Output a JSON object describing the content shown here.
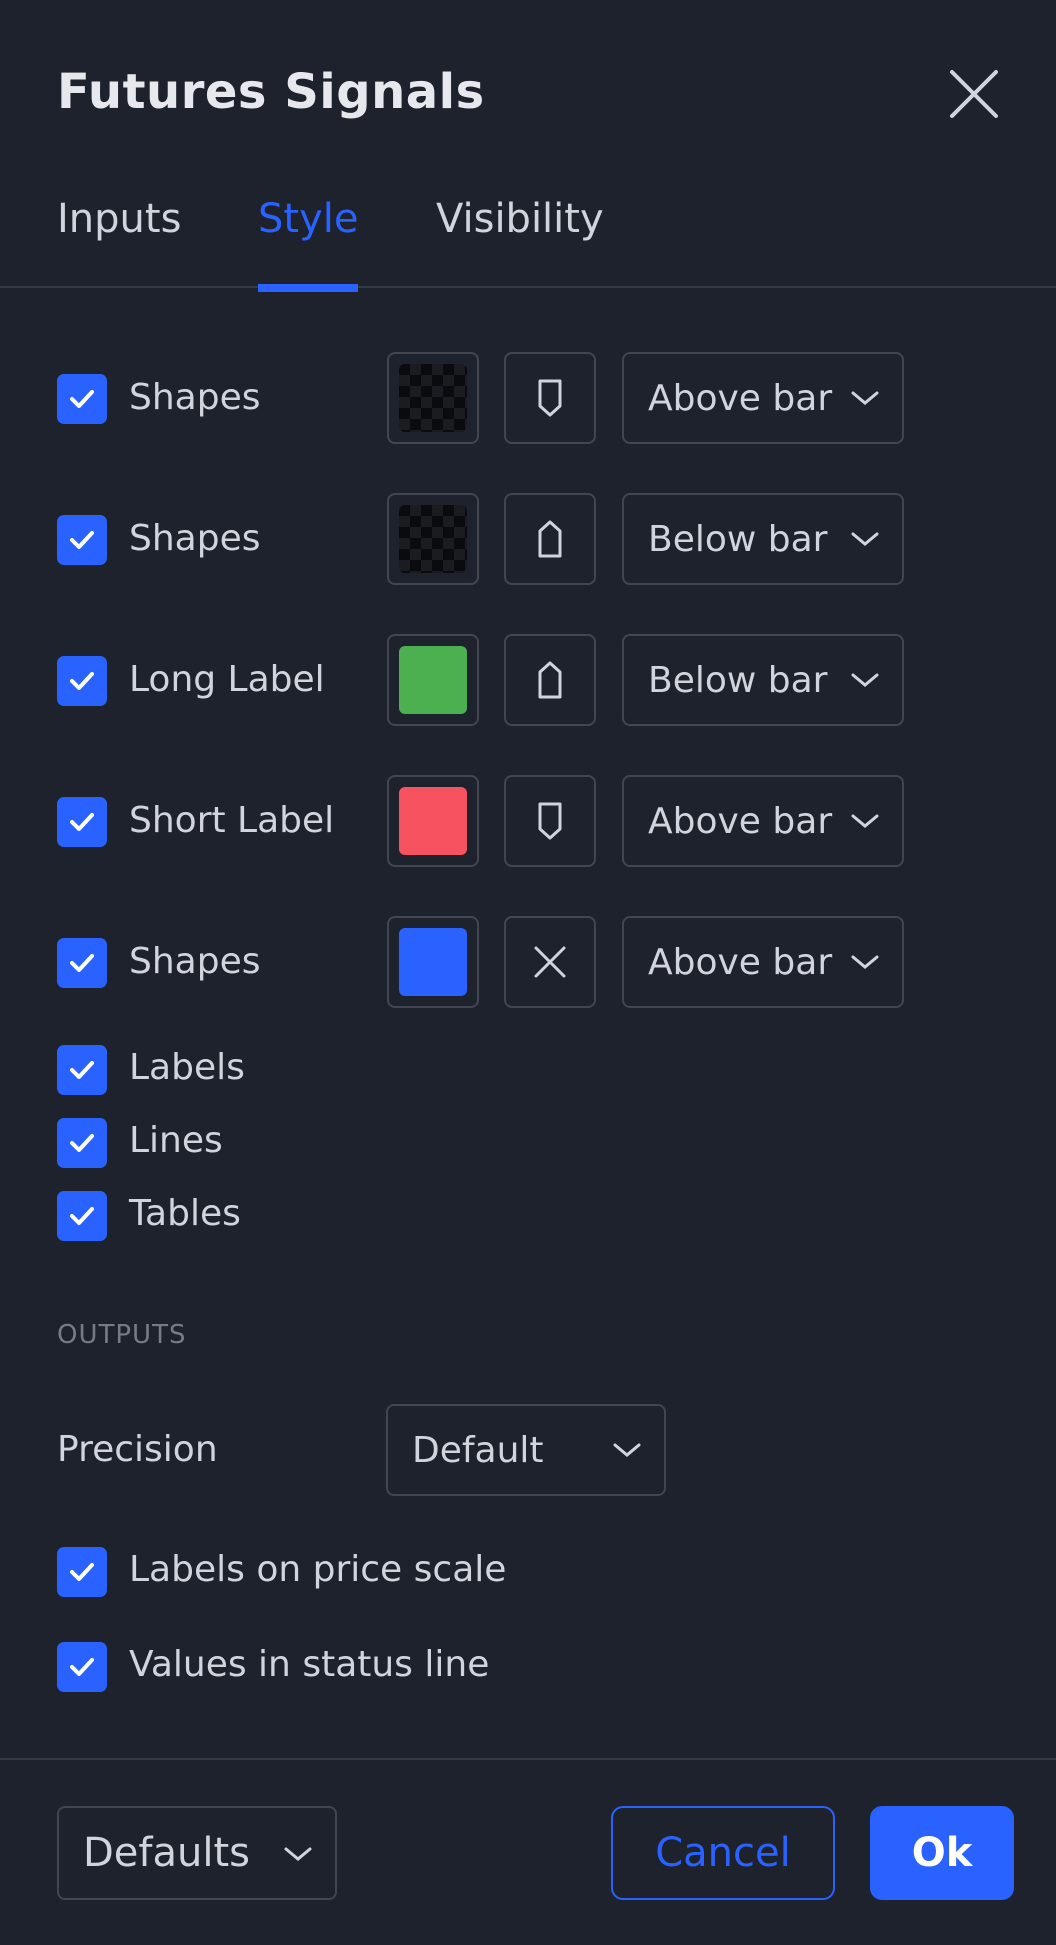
{
  "dialog": {
    "title": "Futures Signals",
    "close_icon": "close-icon"
  },
  "tabs": [
    {
      "label": "Inputs",
      "active": false
    },
    {
      "label": "Style",
      "active": true
    },
    {
      "label": "Visibility",
      "active": false
    }
  ],
  "plots": [
    {
      "label": "Shapes",
      "checked": true,
      "color": "transparent",
      "shape_icon": "flag-down-icon",
      "location": "Above bar"
    },
    {
      "label": "Shapes",
      "checked": true,
      "color": "transparent",
      "shape_icon": "flag-up-icon",
      "location": "Below bar"
    },
    {
      "label": "Long Label",
      "checked": true,
      "color": "#4caf50",
      "shape_icon": "flag-up-icon",
      "location": "Below bar"
    },
    {
      "label": "Short Label",
      "checked": true,
      "color": "#f7525f",
      "shape_icon": "flag-down-icon",
      "location": "Above bar"
    },
    {
      "label": "Shapes",
      "checked": true,
      "color": "#2962ff",
      "shape_icon": "cross-icon",
      "location": "Above bar"
    }
  ],
  "toggles": [
    {
      "label": "Labels",
      "checked": true
    },
    {
      "label": "Lines",
      "checked": true
    },
    {
      "label": "Tables",
      "checked": true
    }
  ],
  "outputs": {
    "section_title": "OUTPUTS",
    "precision_label": "Precision",
    "precision_value": "Default",
    "labels_on_price_scale": {
      "label": "Labels on price scale",
      "checked": true
    },
    "values_in_status_line": {
      "label": "Values in status line",
      "checked": true
    }
  },
  "footer": {
    "defaults_label": "Defaults",
    "cancel_label": "Cancel",
    "ok_label": "Ok"
  },
  "colors": {
    "background": "#1e222d",
    "accent": "#2962ff",
    "border": "#434651",
    "text": "#d1d4dc"
  }
}
